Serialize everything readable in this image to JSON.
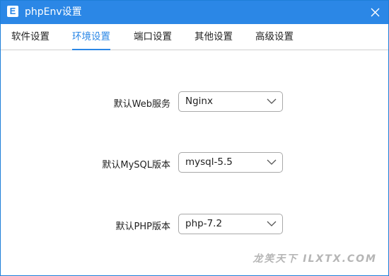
{
  "window": {
    "icon_letter": "E",
    "title": "phpEnv设置",
    "accent_color": "#2b87e6"
  },
  "tabs": [
    {
      "label": "软件设置",
      "active": false
    },
    {
      "label": "环境设置",
      "active": true
    },
    {
      "label": "端口设置",
      "active": false
    },
    {
      "label": "其他设置",
      "active": false
    },
    {
      "label": "高级设置",
      "active": false
    }
  ],
  "settings": {
    "web_server": {
      "label": "默认Web服务",
      "value": "Nginx"
    },
    "mysql_version": {
      "label": "默认MySQL版本",
      "value": "mysql-5.5"
    },
    "php_version": {
      "label": "默认PHP版本",
      "value": "php-7.2"
    }
  },
  "watermark": "龙笑天下 ILXTX.COM"
}
